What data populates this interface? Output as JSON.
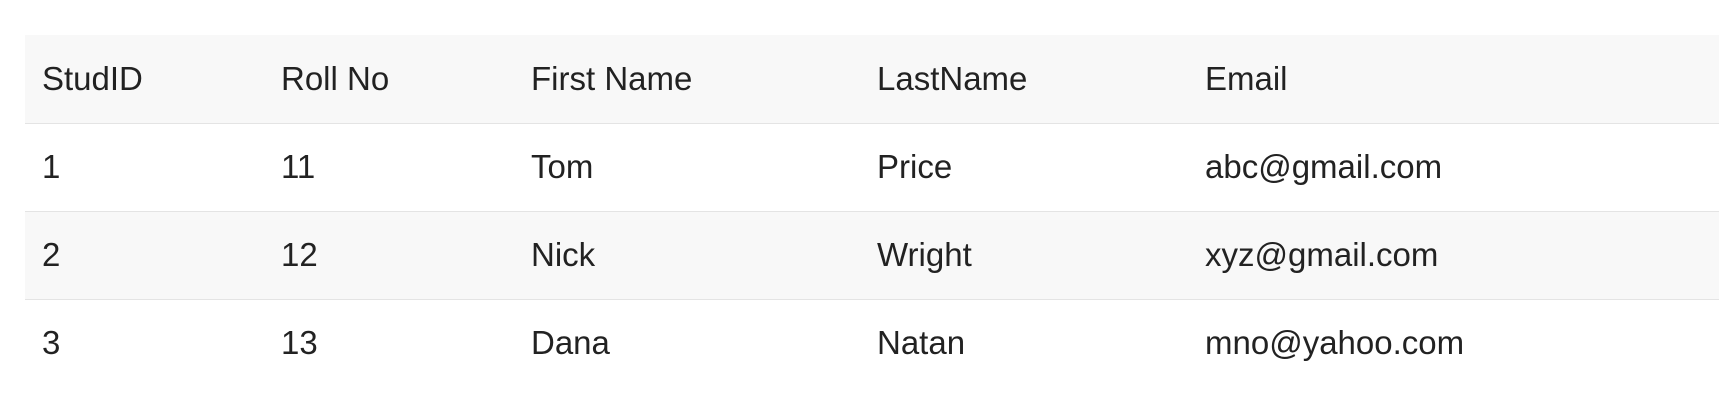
{
  "table": {
    "headers": [
      "StudID",
      "Roll No",
      "First Name",
      "LastName",
      "Email"
    ],
    "rows": [
      [
        "1",
        "11",
        "Tom",
        "Price",
        "abc@gmail.com"
      ],
      [
        "2",
        "12",
        "Nick",
        "Wright",
        "xyz@gmail.com"
      ],
      [
        "3",
        "13",
        "Dana",
        "Natan",
        "mno@yahoo.com"
      ]
    ]
  }
}
